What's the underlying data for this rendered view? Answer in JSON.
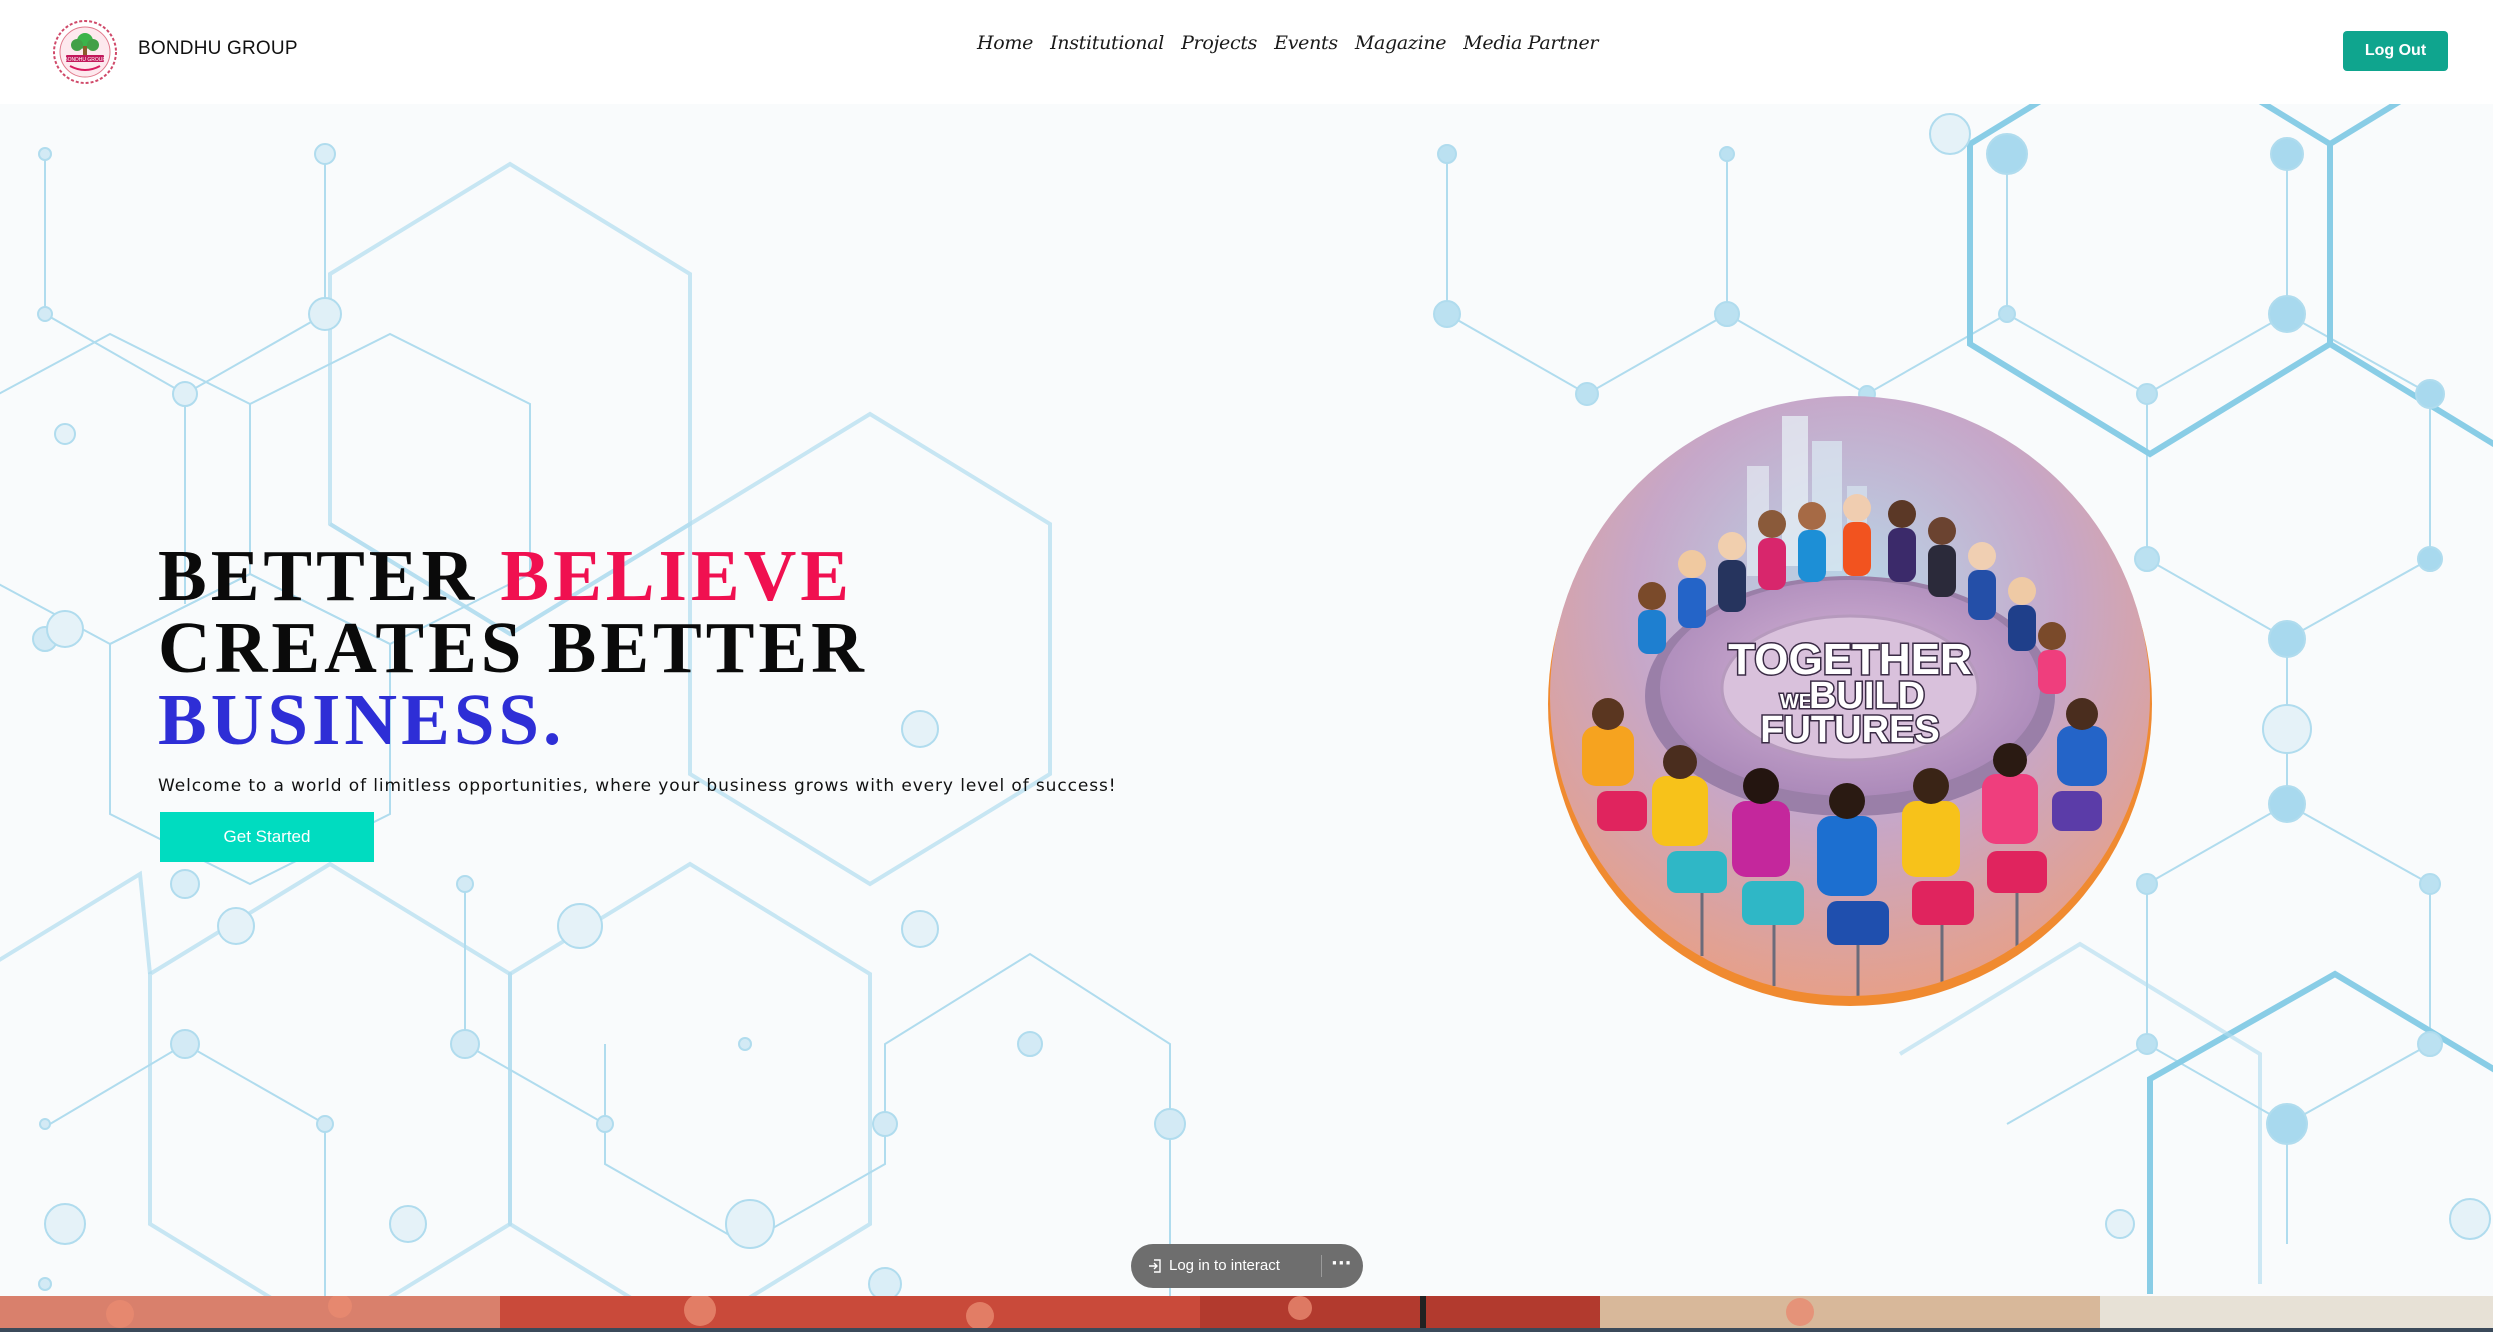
{
  "header": {
    "logo_icon": "bondhu-group-logo",
    "logo_text": "BONDHU GROUP",
    "brand": "BONDHU GROUP",
    "nav": [
      "Home",
      "Institutional",
      "Projects",
      "Events",
      "Magazine",
      "Media Partner"
    ],
    "logout_label": "Log Out"
  },
  "hero": {
    "headline_line1_a": "BETTER",
    "headline_line1_b": "BELIEVE",
    "headline_line2": "CREATES BETTER",
    "headline_line3": "BUSINESS.",
    "subtitle": "Welcome to a world of limitless opportunities, where your business grows with every level of success!",
    "cta_label": "Get Started",
    "illustration": {
      "icon": "team-round-table-illustration",
      "line1": "TOGETHER",
      "line2_small": "WE",
      "line2_big": "BUILD",
      "line3": "FUTURES"
    }
  },
  "overlay": {
    "login_prompt": "Log in to interact",
    "more_icon": "more-options-icon"
  },
  "colors": {
    "accent_teal": "#0fa58e",
    "cta_teal": "#00dcc0",
    "headline_red": "#f01050",
    "headline_blue": "#2e2ed6",
    "hex_lines": "#a8d8ec"
  }
}
